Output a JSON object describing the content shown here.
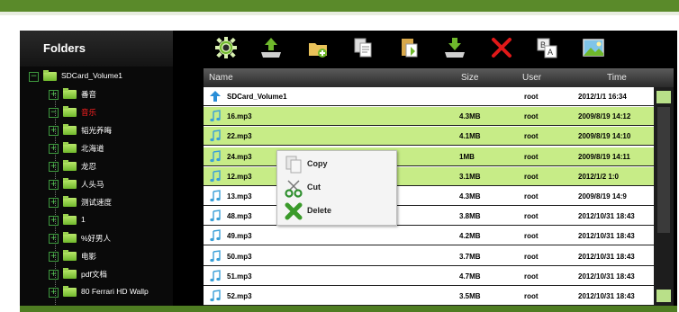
{
  "folders": {
    "title": "Folders",
    "items": [
      {
        "label": "SDCard_Volume1",
        "expander": "−",
        "red": false
      },
      {
        "label": "番音",
        "expander": "+",
        "red": false
      },
      {
        "label": "音乐",
        "expander": "−",
        "red": true
      },
      {
        "label": "韬光养晦",
        "expander": "+",
        "red": false
      },
      {
        "label": "北海道",
        "expander": "+",
        "red": false
      },
      {
        "label": "龙忍",
        "expander": "+",
        "red": false
      },
      {
        "label": "人头马",
        "expander": "+",
        "red": false
      },
      {
        "label": "测试速度",
        "expander": "+",
        "red": false
      },
      {
        "label": "1",
        "expander": "+",
        "red": false
      },
      {
        "label": "%好男人",
        "expander": "+",
        "red": false
      },
      {
        "label": "电影",
        "expander": "+",
        "red": false
      },
      {
        "label": "pdf文档",
        "expander": "+",
        "red": false
      },
      {
        "label": "80 Ferrari HD Wallp",
        "expander": "+",
        "red": false
      }
    ]
  },
  "toolbar": {
    "buttons": [
      "settings-icon",
      "upload-icon",
      "new-folder-icon",
      "copy-icon",
      "paste-icon",
      "download-icon",
      "delete-icon",
      "rename-icon",
      "image-icon"
    ]
  },
  "list": {
    "columns": {
      "name": "Name",
      "size": "Size",
      "user": "User",
      "time": "Time"
    },
    "rows": [
      {
        "name": "SDCard_Volume1",
        "size": "",
        "user": "root",
        "time": "2012/1/1 16:34",
        "type": "up",
        "selected": false
      },
      {
        "name": "16.mp3",
        "size": "4.3MB",
        "user": "root",
        "time": "2009/8/19 14:12",
        "type": "audio",
        "selected": true
      },
      {
        "name": "22.mp3",
        "size": "4.1MB",
        "user": "root",
        "time": "2009/8/19 14:10",
        "type": "audio",
        "selected": true
      },
      {
        "name": "24.mp3",
        "size": "1MB",
        "user": "root",
        "time": "2009/8/19 14:11",
        "type": "audio",
        "selected": true
      },
      {
        "name": "12.mp3",
        "size": "3.1MB",
        "user": "root",
        "time": "2012/1/2 1:0",
        "type": "audio",
        "selected": true
      },
      {
        "name": "13.mp3",
        "size": "4.3MB",
        "user": "root",
        "time": "2009/8/19 14:9",
        "type": "audio",
        "selected": false
      },
      {
        "name": "48.mp3",
        "size": "3.8MB",
        "user": "root",
        "time": "2012/10/31 18:43",
        "type": "audio",
        "selected": false
      },
      {
        "name": "49.mp3",
        "size": "4.2MB",
        "user": "root",
        "time": "2012/10/31 18:43",
        "type": "audio",
        "selected": false
      },
      {
        "name": "50.mp3",
        "size": "3.7MB",
        "user": "root",
        "time": "2012/10/31 18:43",
        "type": "audio",
        "selected": false
      },
      {
        "name": "51.mp3",
        "size": "4.7MB",
        "user": "root",
        "time": "2012/10/31 18:43",
        "type": "audio",
        "selected": false
      },
      {
        "name": "52.mp3",
        "size": "3.5MB",
        "user": "root",
        "time": "2012/10/31 18:43",
        "type": "audio",
        "selected": false
      }
    ]
  },
  "context_menu": {
    "items": [
      {
        "label": "Copy",
        "icon": "copy-icon"
      },
      {
        "label": "Cut",
        "icon": "scissors-icon"
      },
      {
        "label": "Delete",
        "icon": "delete-icon"
      }
    ]
  },
  "colors": {
    "accent": "#5a8a2a",
    "selected_row": "#c7ec87",
    "folder_label_active": "#ff2020"
  }
}
